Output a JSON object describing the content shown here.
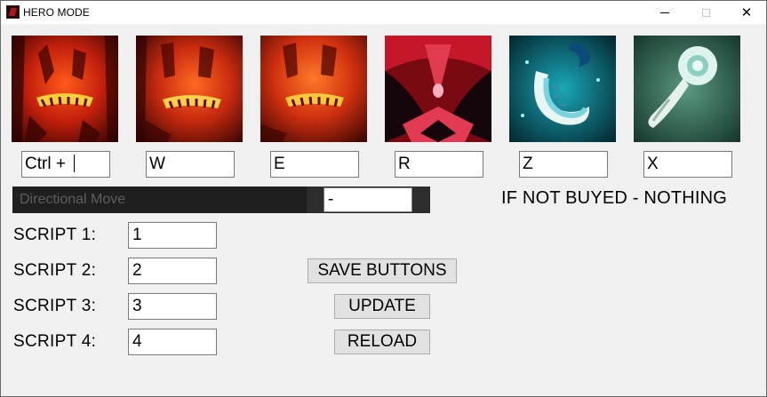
{
  "window": {
    "title": "HERO MODE",
    "icon": "app-icon",
    "controls": [
      "minimize-icon",
      "maximize-icon",
      "close-icon"
    ]
  },
  "abilities": [
    {
      "name": "ability-1",
      "hotkey": "Ctrl + "
    },
    {
      "name": "ability-2",
      "hotkey": "W"
    },
    {
      "name": "ability-3",
      "hotkey": "E"
    },
    {
      "name": "ability-4",
      "hotkey": "R"
    },
    {
      "name": "ability-5",
      "hotkey": "Z"
    },
    {
      "name": "ability-6",
      "hotkey": "X"
    }
  ],
  "directional": {
    "label": "Directional Move",
    "value": "-"
  },
  "note": "IF NOT BUYED - NOTHING",
  "scripts": [
    {
      "label": "SCRIPT 1:",
      "value": "1"
    },
    {
      "label": "SCRIPT 2:",
      "value": "2"
    },
    {
      "label": "SCRIPT 3:",
      "value": "3"
    },
    {
      "label": "SCRIPT 4:",
      "value": "4"
    }
  ],
  "buttons": {
    "save": "SAVE BUTTONS",
    "update": "UPDATE",
    "reload": "RELOAD"
  },
  "colors": {
    "background": "#f0f0f0",
    "dark_bar": "#1f1f1f",
    "button_face": "#e1e1e1"
  }
}
